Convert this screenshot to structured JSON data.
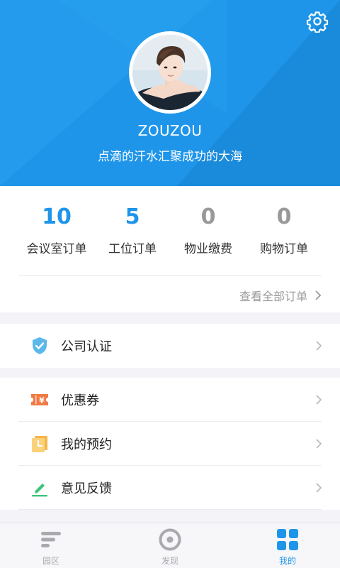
{
  "profile": {
    "username": "ZOUZOU",
    "motto": "点滴的汗水汇聚成功的大海"
  },
  "stats": [
    {
      "count": "10",
      "label": "会议室订单",
      "color": "#1e95e9"
    },
    {
      "count": "5",
      "label": "工位订单",
      "color": "#1e95e9"
    },
    {
      "count": "0",
      "label": "物业缴费",
      "color": "#999999"
    },
    {
      "count": "0",
      "label": "购物订单",
      "color": "#999999"
    }
  ],
  "orders_link": "查看全部订单",
  "menu": {
    "company_auth": "公司认证",
    "coupons": "优惠券",
    "reservations": "我的预约",
    "feedback": "意见反馈"
  },
  "nav": {
    "park": "园区",
    "discover": "发现",
    "mine": "我的"
  },
  "colors": {
    "accent": "#1e95e9",
    "nav_inactive": "#a9aab0"
  }
}
